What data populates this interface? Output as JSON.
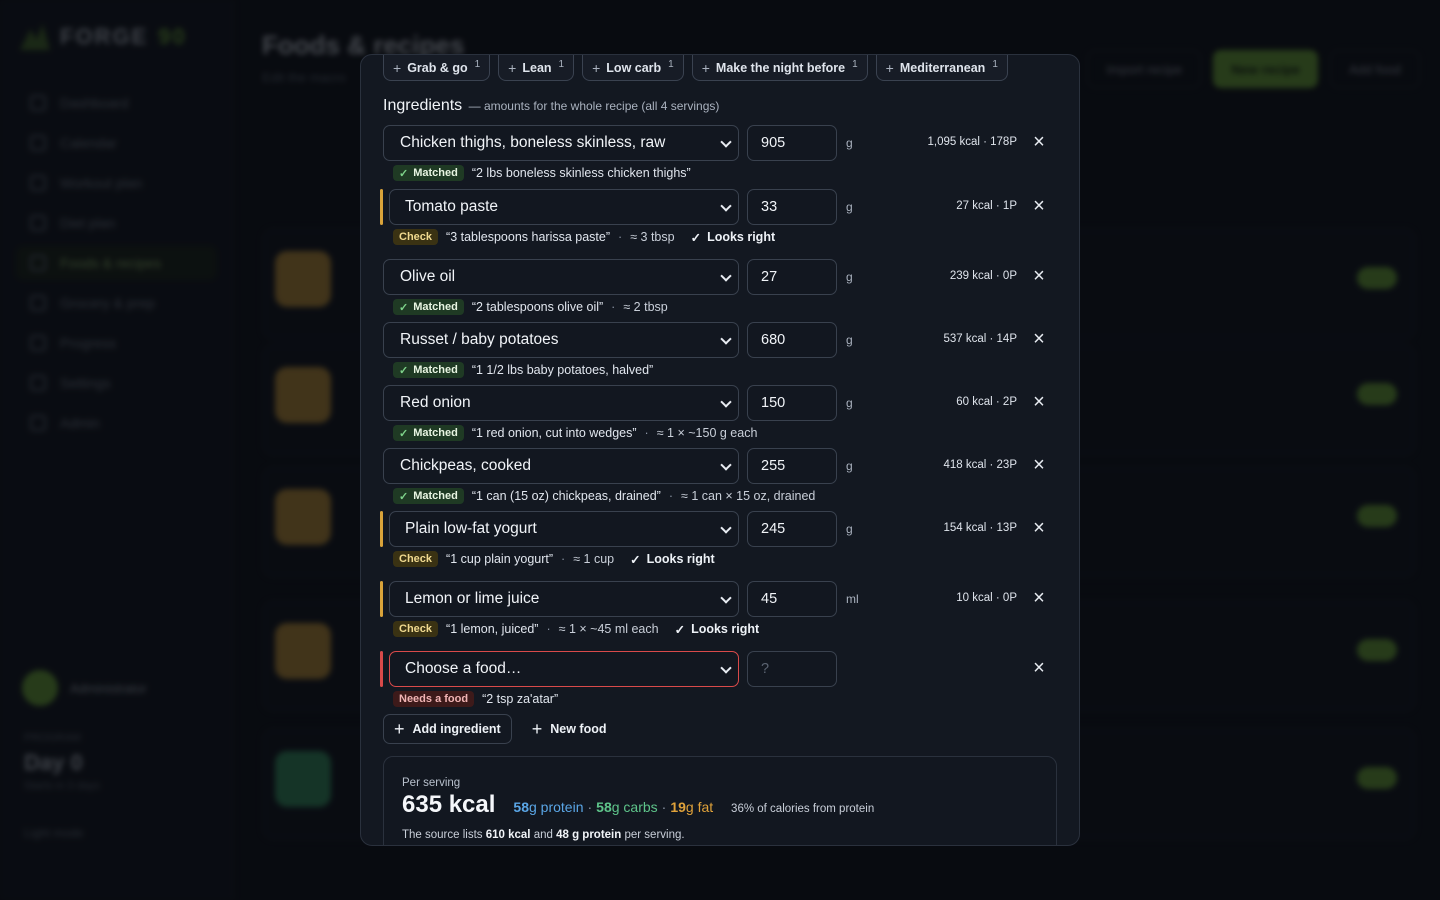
{
  "bg": {
    "app_name": "FORGE",
    "app_name_suffix": "90",
    "nav": [
      "Dashboard",
      "Calendar",
      "Workout plan",
      "Diet plan",
      "Foods & recipes",
      "Grocery & prep",
      "Progress",
      "Settings",
      "Admin"
    ],
    "page_title": "Foods & recipes",
    "page_sub": "Edit the macro",
    "btn_import": "Import recipe",
    "btn_new_recipe": "New recipe",
    "btn_add_food": "Add food",
    "user_name": "Administrator",
    "program_label": "PROGRAM",
    "program_day": "Day 0",
    "program_sub": "Starts in 3 days",
    "light_mode": "Light mode"
  },
  "tags": [
    {
      "label": "Grab & go",
      "count": "1"
    },
    {
      "label": "Lean",
      "count": "1"
    },
    {
      "label": "Low carb",
      "count": "1"
    },
    {
      "label": "Make the night before",
      "count": "1"
    },
    {
      "label": "Mediterranean",
      "count": "1"
    }
  ],
  "ingredients_title": "Ingredients",
  "ingredients_note": "— amounts for the whole recipe (all 4 servings)",
  "ingredients": [
    {
      "food": "Chicken thighs, boneless skinless, raw",
      "qty": "905",
      "unit": "g",
      "kcal": "1,095 kcal · 178P",
      "status": "Matched",
      "source": "“2 lbs boneless skinless chicken thighs”",
      "estimate": "",
      "looks_right": ""
    },
    {
      "food": "Tomato paste",
      "qty": "33",
      "unit": "g",
      "kcal": "27 kcal · 1P",
      "status": "Check",
      "source": "“3 tablespoons harissa paste”",
      "estimate": "≈ 3 tbsp",
      "looks_right": "Looks right"
    },
    {
      "food": "Olive oil",
      "qty": "27",
      "unit": "g",
      "kcal": "239 kcal · 0P",
      "status": "Matched",
      "source": "“2 tablespoons olive oil”",
      "estimate": "≈ 2 tbsp",
      "looks_right": ""
    },
    {
      "food": "Russet / baby potatoes",
      "qty": "680",
      "unit": "g",
      "kcal": "537 kcal · 14P",
      "status": "Matched",
      "source": "“1 1/2 lbs baby potatoes, halved”",
      "estimate": "",
      "looks_right": ""
    },
    {
      "food": "Red onion",
      "qty": "150",
      "unit": "g",
      "kcal": "60 kcal · 2P",
      "status": "Matched",
      "source": "“1 red onion, cut into wedges”",
      "estimate": "≈ 1 × ~150 g each",
      "looks_right": ""
    },
    {
      "food": "Chickpeas, cooked",
      "qty": "255",
      "unit": "g",
      "kcal": "418 kcal · 23P",
      "status": "Matched",
      "source": "“1 can (15 oz) chickpeas, drained”",
      "estimate": "≈ 1 can × 15 oz, drained",
      "looks_right": ""
    },
    {
      "food": "Plain low-fat yogurt",
      "qty": "245",
      "unit": "g",
      "kcal": "154 kcal · 13P",
      "status": "Check",
      "source": "“1 cup plain yogurt”",
      "estimate": "≈ 1 cup",
      "looks_right": "Looks right"
    },
    {
      "food": "Lemon or lime juice",
      "qty": "45",
      "unit": "ml",
      "kcal": "10 kcal · 0P",
      "status": "Check",
      "source": "“1 lemon, juiced”",
      "estimate": "≈ 1 × ~45 ml each",
      "looks_right": "Looks right"
    },
    {
      "food": "Choose a food…",
      "qty": "?",
      "unit": "",
      "kcal": "",
      "status": "Needs a food",
      "source": "“2 tsp za'atar”",
      "estimate": "",
      "looks_right": ""
    }
  ],
  "add_ingredient": "Add ingredient",
  "new_food": "New food",
  "summary": {
    "per_serving": "Per serving",
    "kcal": "635 kcal",
    "protein_val": "58",
    "protein_lbl": "g protein",
    "carbs_val": "58",
    "carbs_lbl": "g carbs",
    "fat_val": "19",
    "fat_lbl": "g fat",
    "pct": "36% of calories from protein",
    "src_pre": "The source lists",
    "src_kcal": "610 kcal",
    "src_mid": "and",
    "src_protein": "48 g protein",
    "src_post": "per serving."
  },
  "colors": {
    "matched": "#1f3a24",
    "check": "#3a3213",
    "needs": "#3d1a1a",
    "accent": "#7bbf3a",
    "error": "#d94a4a"
  }
}
